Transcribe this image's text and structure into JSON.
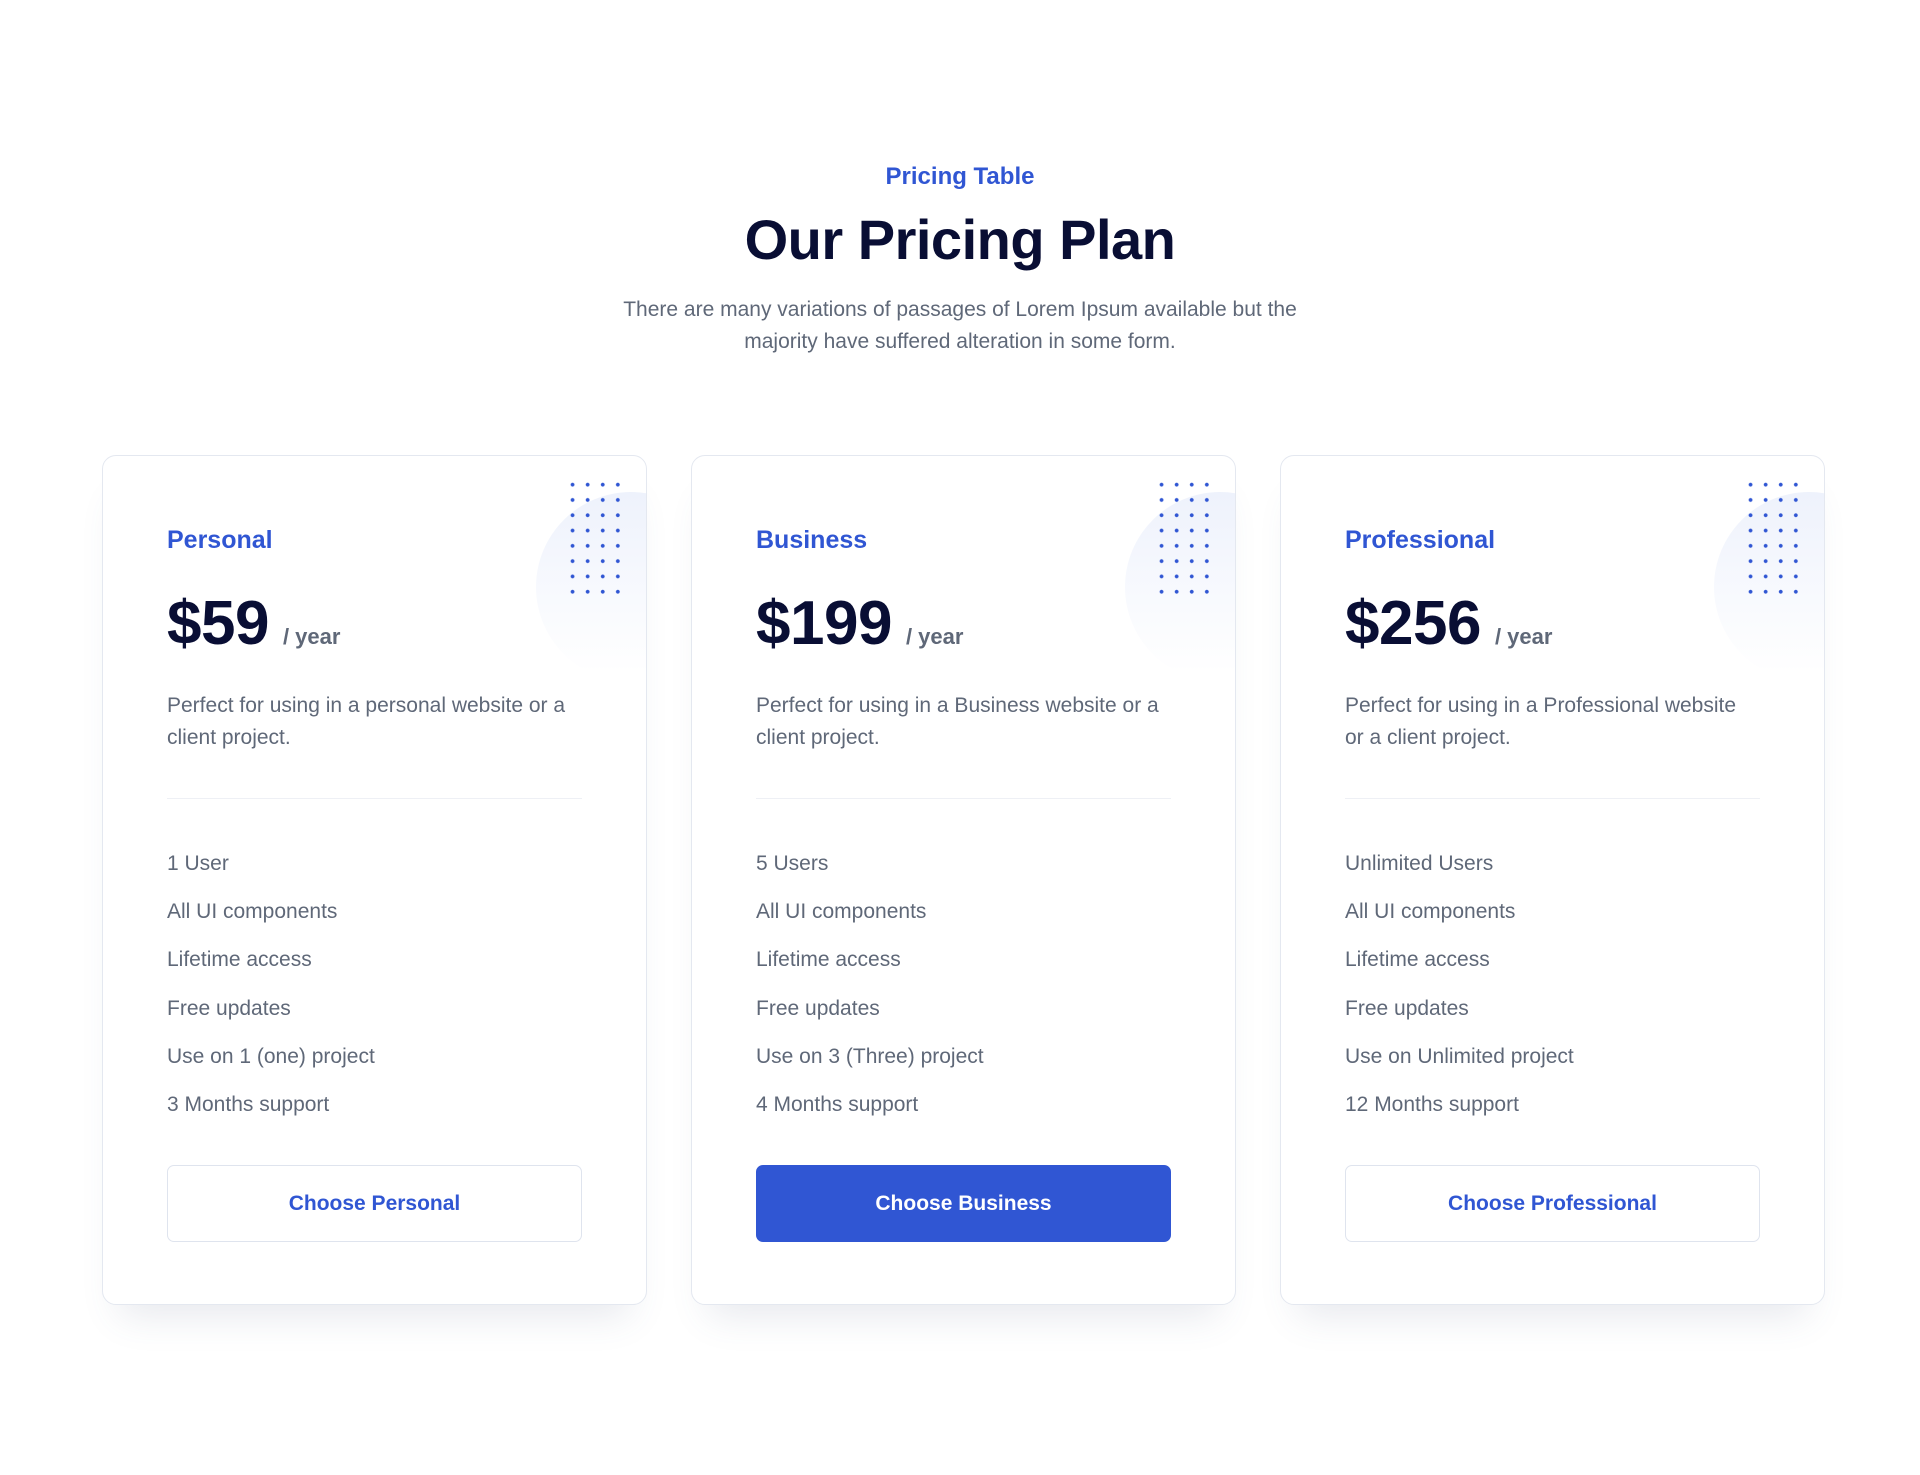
{
  "header": {
    "eyebrow": "Pricing Table",
    "title": "Our Pricing Plan",
    "description": "There are many variations of passages of Lorem Ipsum available but the majority have suffered alteration in some form."
  },
  "colors": {
    "accent": "#3056d3",
    "heading": "#090e34",
    "body_text": "#5f6878",
    "card_border": "#e4e8f0"
  },
  "plans": [
    {
      "name": "Personal",
      "price": "$59",
      "period": "/ year",
      "description": "Perfect for using in a personal website or a client project.",
      "features": [
        "1 User",
        "All UI components",
        "Lifetime access",
        "Free updates",
        "Use on 1 (one) project",
        "3 Months support"
      ],
      "button_label": "Choose Personal",
      "button_style": "outline"
    },
    {
      "name": "Business",
      "price": "$199",
      "period": "/ year",
      "description": "Perfect for using in a Business website or a client project.",
      "features": [
        "5 Users",
        "All UI components",
        "Lifetime access",
        "Free updates",
        "Use on 3 (Three) project",
        "4 Months support"
      ],
      "button_label": "Choose Business",
      "button_style": "solid"
    },
    {
      "name": "Professional",
      "price": "$256",
      "period": "/ year",
      "description": "Perfect for using in a Professional website or a client project.",
      "features": [
        "Unlimited Users",
        "All UI components",
        "Lifetime access",
        "Free updates",
        "Use on Unlimited project",
        "12 Months support"
      ],
      "button_label": "Choose Professional",
      "button_style": "outline"
    }
  ]
}
